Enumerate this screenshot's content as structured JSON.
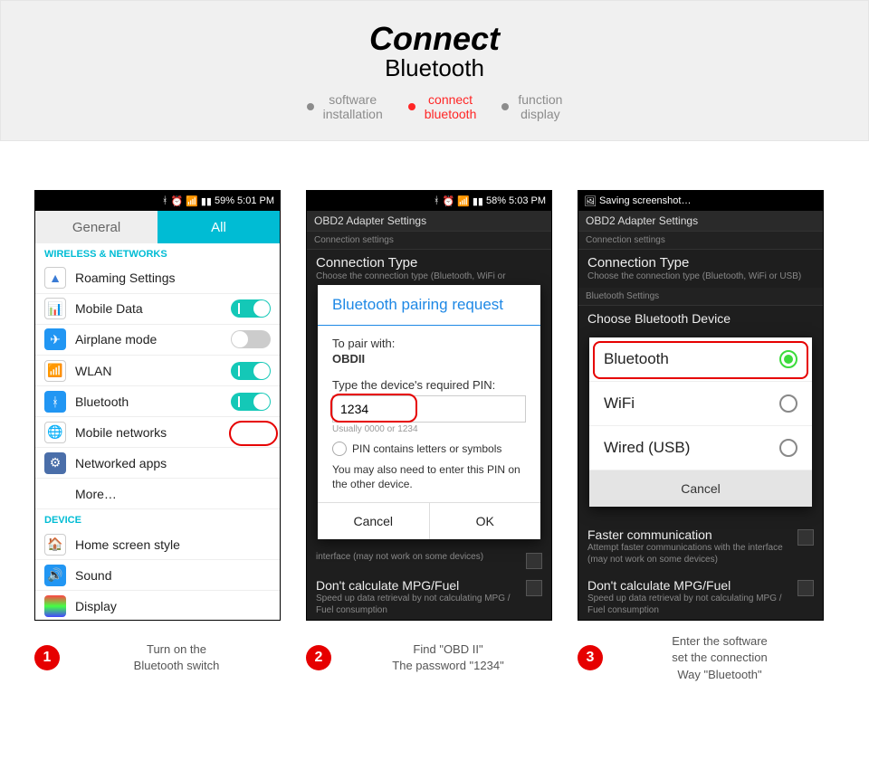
{
  "hero": {
    "title": "Connect",
    "subtitle": "Bluetooth"
  },
  "breadcrumb": [
    {
      "l1": "software",
      "l2": "installation",
      "active": false
    },
    {
      "l1": "connect",
      "l2": "bluetooth",
      "active": true
    },
    {
      "l1": "function",
      "l2": "display",
      "active": false
    }
  ],
  "s1": {
    "status": "59% 5:01 PM",
    "tabs": {
      "general": "General",
      "all": "All"
    },
    "section_wireless": "WIRELESS & NETWORKS",
    "items": [
      {
        "label": "Roaming Settings",
        "toggle": null
      },
      {
        "label": "Mobile Data",
        "toggle": "on"
      },
      {
        "label": "Airplane mode",
        "toggle": "off"
      },
      {
        "label": "WLAN",
        "toggle": "on"
      },
      {
        "label": "Bluetooth",
        "toggle": "on"
      },
      {
        "label": "Mobile networks",
        "toggle": null
      },
      {
        "label": "Networked apps",
        "toggle": null
      }
    ],
    "more": "More…",
    "section_device": "DEVICE",
    "device_items": [
      "Home screen style",
      "Sound",
      "Display"
    ]
  },
  "s2": {
    "status": "58% 5:03 PM",
    "header": "OBD2 Adapter Settings",
    "header_sub": "Connection settings",
    "conn_type": "Connection Type",
    "conn_desc": "Choose the connection type (Bluetooth, WiFi or",
    "modal": {
      "title": "Bluetooth pairing request",
      "pair_with": "To pair with:",
      "device": "OBDII",
      "prompt": "Type the device's required PIN:",
      "pin": "1234",
      "hint": "Usually 0000 or 1234",
      "checkbox": "PIN contains letters or symbols",
      "note": "You may also need to enter this PIN on the other device.",
      "cancel": "Cancel",
      "ok": "OK"
    },
    "bg_block1": "interface (may not work on some devices)",
    "bg_block2_t": "Don't calculate MPG/Fuel",
    "bg_block2_d": "Speed up data retrieval by not calculating MPG / Fuel consumption"
  },
  "s3": {
    "status": "Saving screenshot…",
    "header": "OBD2 Adapter Settings",
    "header_sub": "Connection settings",
    "conn_type": "Connection Type",
    "conn_desc": "Choose the connection type (Bluetooth, WiFi or USB)",
    "bt_settings": "Bluetooth Settings",
    "choose": "Choose Bluetooth Device",
    "options": [
      "Bluetooth",
      "WiFi",
      "Wired (USB)"
    ],
    "cancel": "Cancel",
    "bg1_t": "Faster communication",
    "bg1_d": "Attempt faster communications with the interface (may not work on some devices)",
    "bg2_t": "Don't calculate MPG/Fuel",
    "bg2_d": "Speed up data retrieval by not calculating MPG / Fuel consumption"
  },
  "captions": [
    "Turn on the\nBluetooth switch",
    "Find  \"OBD II\"\nThe password \"1234\"",
    "Enter the software\nset the connection\nWay \"Bluetooth\""
  ]
}
